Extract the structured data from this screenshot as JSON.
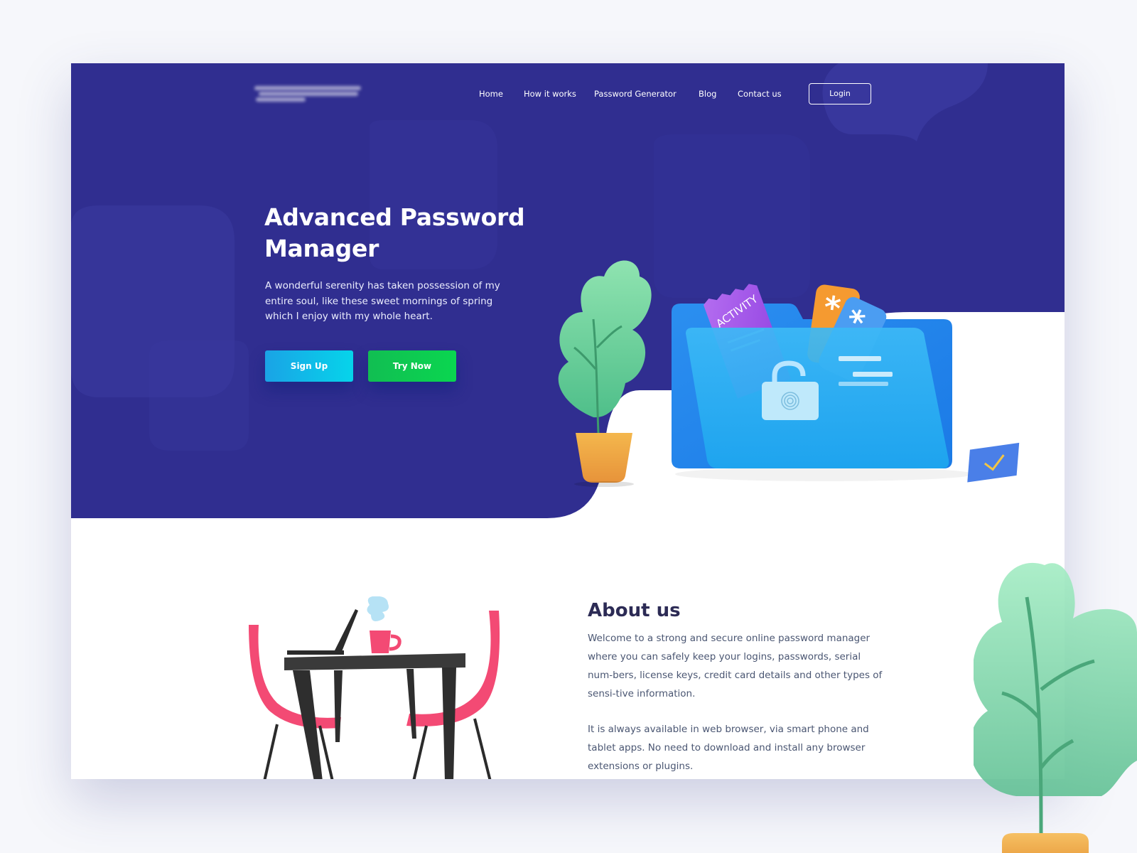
{
  "colors": {
    "hero_bg": "#302e90",
    "hero_shape": "#3a3aa0",
    "signup_gradient": [
      "#1aa3e6",
      "#06d4ea"
    ],
    "try_gradient": [
      "#11be52",
      "#0ad650"
    ],
    "about_title": "#2c2b55",
    "about_text": "#4a5672"
  },
  "nav": {
    "logo_text": "",
    "links": [
      "Home",
      "How it works",
      "Password Generator",
      "Blog",
      "Contact us"
    ],
    "login_label": "Login"
  },
  "hero": {
    "title": "Advanced Password Manager",
    "description": "A wonderful serenity has taken possession of my entire soul, like these sweet mornings of spring which I enjoy with my whole heart.",
    "signup_label": "Sign Up",
    "try_label": "Try Now",
    "illustration": {
      "card_label": "ACTIVITY",
      "icons": [
        "folder-icon",
        "padlock-icon",
        "fingerprint-icon",
        "asterisk-icon",
        "checkmark-icon",
        "plant-icon"
      ]
    }
  },
  "about": {
    "title": "About us",
    "paragraph1": "Welcome to a strong and secure online password manager where you can safely keep your logins, passwords, serial num-bers, license keys, credit card details and other types of sensi-tive information.",
    "paragraph2": "It is always available in web browser, via smart phone and tablet apps. No need to download and install any browser extensions or plugins.",
    "illustration_icons": [
      "table-icon",
      "chair-icon",
      "laptop-icon",
      "coffee-cup-icon"
    ]
  }
}
